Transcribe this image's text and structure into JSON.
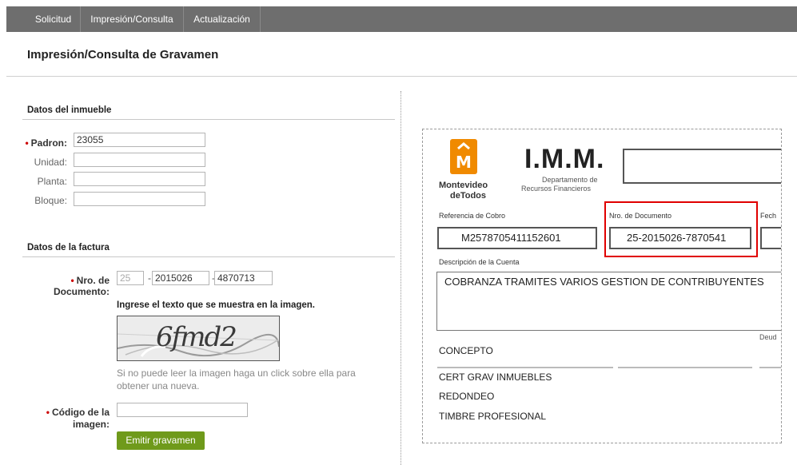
{
  "nav": {
    "tabs": [
      {
        "label": "Solicitud"
      },
      {
        "label": "Impresión/Consulta"
      },
      {
        "label": "Actualización"
      }
    ]
  },
  "page": {
    "title": "Impresión/Consulta de Gravamen"
  },
  "inmueble": {
    "heading": "Datos del inmueble",
    "padron_label": "Padron:",
    "padron_value": "23055",
    "unidad_label": "Unidad:",
    "unidad_value": "",
    "planta_label": "Planta:",
    "planta_value": "",
    "bloque_label": "Bloque:",
    "bloque_value": ""
  },
  "factura": {
    "heading": "Datos de la factura",
    "nro_label_1": "Nro. de",
    "nro_label_2": "Documento:",
    "nro_part1": "25",
    "nro_part2": "2015026",
    "nro_part3": "4870713",
    "captcha_instruction": "Ingrese el texto que se muestra en la imagen.",
    "captcha_text": "6fmd2",
    "captcha_hint_1": "Si no puede leer la imagen haga un click sobre ella para",
    "captcha_hint_2": "obtener una nueva.",
    "codigo_label_1": "Código de la",
    "codigo_label_2": "imagen:",
    "codigo_value": "",
    "submit_label": "Emitir gravamen"
  },
  "document": {
    "logo_line1": "Montevideo",
    "logo_line2": "deTodos",
    "org": "I.M.M.",
    "dept_line1": "Departamento de",
    "dept_line2": "Recursos Financieros",
    "ref_label": "Referencia de Cobro",
    "ref_value": "M2578705411152601",
    "nro_label": "Nro. de Documento",
    "nro_value": "25-2015026-7870541",
    "fecha_label": "Fech",
    "desc_label": "Descripción de la Cuenta",
    "desc_value": "COBRANZA TRAMITES VARIOS GESTION DE CONTRIBUYENTES",
    "deuda_label": "Deud",
    "concepto_label": "CONCEPTO",
    "items": [
      "CERT GRAV  INMUEBLES",
      "REDONDEO",
      "TIMBRE PROFESIONAL"
    ]
  },
  "colors": {
    "nav_bg": "#6e6e6e",
    "button_green": "#6f9a1b",
    "required_star": "#cc0000",
    "highlight_red": "#e00000",
    "logo_orange": "#f08a00"
  }
}
